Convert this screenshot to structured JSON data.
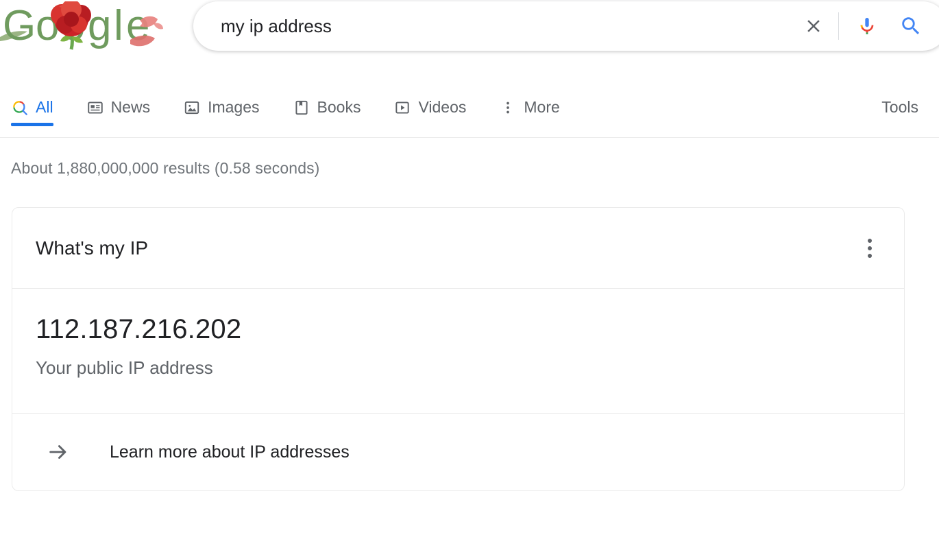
{
  "logo": {
    "name": "google-doodle-carnation",
    "alt": "Google",
    "letters": "Google",
    "letter_color": "#6f9b5e",
    "flower_color": "#cc2127",
    "petal_color": "#e8827f"
  },
  "search": {
    "query": "my ip address",
    "placeholder": "Search",
    "clear_label": "Clear",
    "mic_label": "Search by voice",
    "search_label": "Google Search"
  },
  "nav": {
    "tabs": [
      {
        "label": "All",
        "icon": "search-icon",
        "active": true
      },
      {
        "label": "News",
        "icon": "news-icon",
        "active": false
      },
      {
        "label": "Images",
        "icon": "image-icon",
        "active": false
      },
      {
        "label": "Books",
        "icon": "book-icon",
        "active": false
      },
      {
        "label": "Videos",
        "icon": "video-icon",
        "active": false
      },
      {
        "label": "More",
        "icon": "more-vert-icon",
        "active": false
      }
    ],
    "tools_label": "Tools",
    "active_color": "#1a73e8",
    "inactive_color": "#5f6368"
  },
  "results": {
    "stats": "About 1,880,000,000 results (0.58 seconds)"
  },
  "answer_card": {
    "title": "What's my IP",
    "menu_label": "About this result",
    "ip_address": "112.187.216.202",
    "ip_caption": "Your public IP address",
    "footer_link": "Learn more about IP addresses"
  }
}
